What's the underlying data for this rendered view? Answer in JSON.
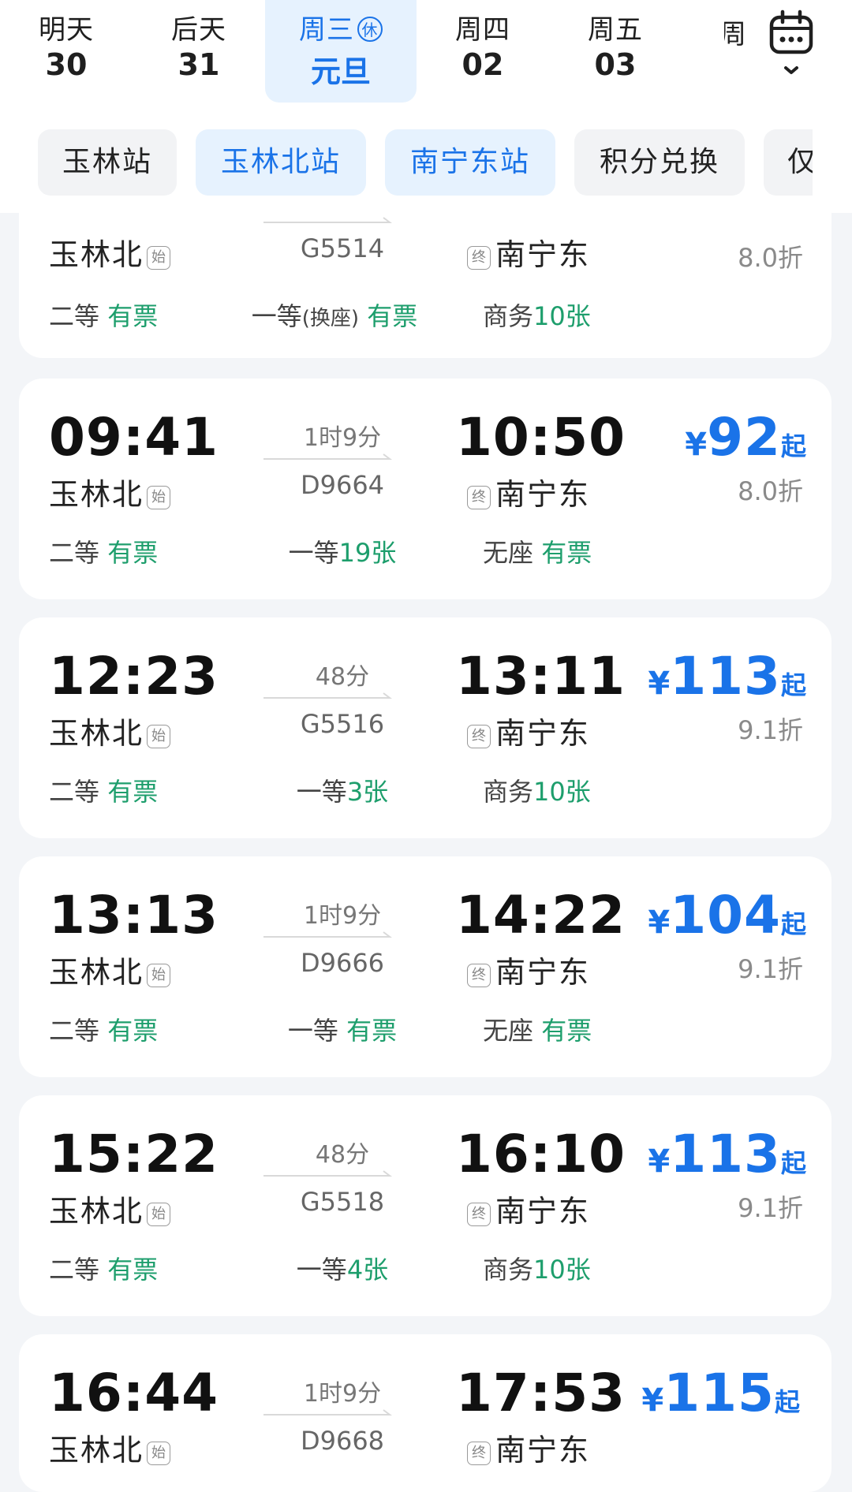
{
  "dates": [
    {
      "weekday": "明天",
      "day": "30"
    },
    {
      "weekday": "后天",
      "day": "31"
    },
    {
      "weekday": "周三",
      "day": "元旦",
      "badge": "休",
      "active": true
    },
    {
      "weekday": "周四",
      "day": "02"
    },
    {
      "weekday": "周五",
      "day": "03"
    }
  ],
  "partial_date": "周",
  "stations": [
    "玉林站",
    "玉林北站",
    "南宁东站",
    "积分兑换",
    "仅"
  ],
  "station_selected": [
    1,
    2
  ],
  "tags": {
    "origin": "始",
    "terminal": "终"
  },
  "price_unit": {
    "currency": "¥",
    "suffix": "起"
  },
  "trains": [
    {
      "dep_time": "",
      "arr_time": "",
      "price": "",
      "from": "玉林北",
      "to": "南宁东",
      "duration": "",
      "train_no": "G5514",
      "discount": "8.0折",
      "seats": [
        {
          "class": "二等",
          "status": "有票"
        },
        {
          "class": "一等",
          "note": "(换座)",
          "status": "有票"
        },
        {
          "class": "商务",
          "status": "10张"
        }
      ]
    },
    {
      "dep_time": "09:41",
      "arr_time": "10:50",
      "price": "92",
      "from": "玉林北",
      "to": "南宁东",
      "duration": "1时9分",
      "train_no": "D9664",
      "discount": "8.0折",
      "seats": [
        {
          "class": "二等",
          "status": "有票"
        },
        {
          "class": "一等",
          "status": "19张"
        },
        {
          "class": "无座",
          "status": "有票"
        }
      ]
    },
    {
      "dep_time": "12:23",
      "arr_time": "13:11",
      "price": "113",
      "from": "玉林北",
      "to": "南宁东",
      "duration": "48分",
      "train_no": "G5516",
      "discount": "9.1折",
      "seats": [
        {
          "class": "二等",
          "status": "有票"
        },
        {
          "class": "一等",
          "status": "3张"
        },
        {
          "class": "商务",
          "status": "10张"
        }
      ]
    },
    {
      "dep_time": "13:13",
      "arr_time": "14:22",
      "price": "104",
      "from": "玉林北",
      "to": "南宁东",
      "duration": "1时9分",
      "train_no": "D9666",
      "discount": "9.1折",
      "seats": [
        {
          "class": "二等",
          "status": "有票"
        },
        {
          "class": "一等",
          "status": "有票"
        },
        {
          "class": "无座",
          "status": "有票"
        }
      ]
    },
    {
      "dep_time": "15:22",
      "arr_time": "16:10",
      "price": "113",
      "from": "玉林北",
      "to": "南宁东",
      "duration": "48分",
      "train_no": "G5518",
      "discount": "9.1折",
      "seats": [
        {
          "class": "二等",
          "status": "有票"
        },
        {
          "class": "一等",
          "status": "4张"
        },
        {
          "class": "商务",
          "status": "10张"
        }
      ]
    },
    {
      "dep_time": "16:44",
      "arr_time": "17:53",
      "price": "115",
      "from": "玉林北",
      "to": "南宁东",
      "duration": "1时9分",
      "train_no": "D9668",
      "discount": "",
      "seats": []
    }
  ],
  "colors": {
    "accent": "#1a73e8",
    "available": "#1d9e6c",
    "background": "#f3f5f8"
  }
}
